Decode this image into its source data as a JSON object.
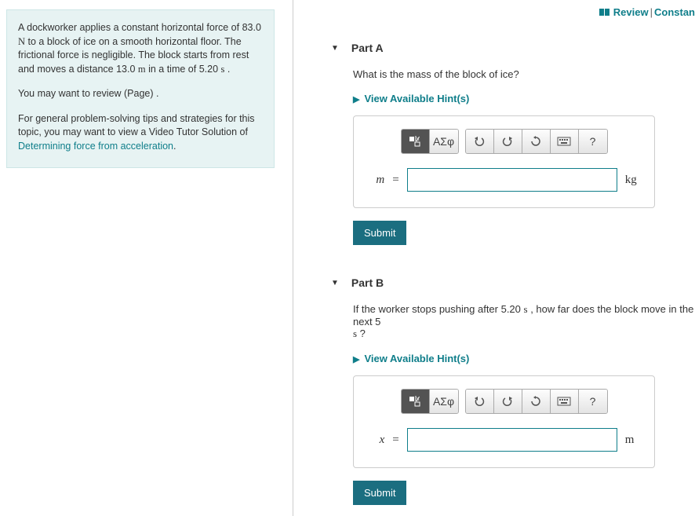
{
  "topnav": {
    "review": "Review",
    "constants": "Constan"
  },
  "problem": {
    "p1_before": "A dockworker applies a constant horizontal force of 83.0 ",
    "p1_unit_N": "N",
    "p1_mid": " to a block of ice on a smooth horizontal floor. The frictional force is negligible. The block starts from rest and moves a distance 13.0 ",
    "p1_unit_m": "m",
    "p1_after_m": " in a time of 5.20 ",
    "p1_unit_s": "s",
    "p1_end": " .",
    "p2": "You may want to review (Page) .",
    "p3_before": "For general problem-solving tips and strategies for this topic, you may want to view a Video Tutor Solution of ",
    "p3_link": "Determining force from acceleration",
    "p3_end": "."
  },
  "partA": {
    "header": "Part A",
    "question": "What is the mass of the block of ice?",
    "hints": "View Available Hint(s)",
    "symbols": "ΑΣφ",
    "var": "m",
    "eq": "=",
    "value": "",
    "unit": "kg",
    "submit": "Submit"
  },
  "partB": {
    "header": "Part B",
    "q_before": "If the worker stops pushing after 5.20 ",
    "q_unit1": "s",
    "q_mid": " , how far does the block move in the next 5",
    "q_unit2": "s",
    "q_end": " ?",
    "hints": "View Available Hint(s)",
    "symbols": "ΑΣφ",
    "var": "x",
    "eq": "=",
    "value": "",
    "unit": "m",
    "submit": "Submit"
  },
  "icons": {
    "help": "?"
  }
}
